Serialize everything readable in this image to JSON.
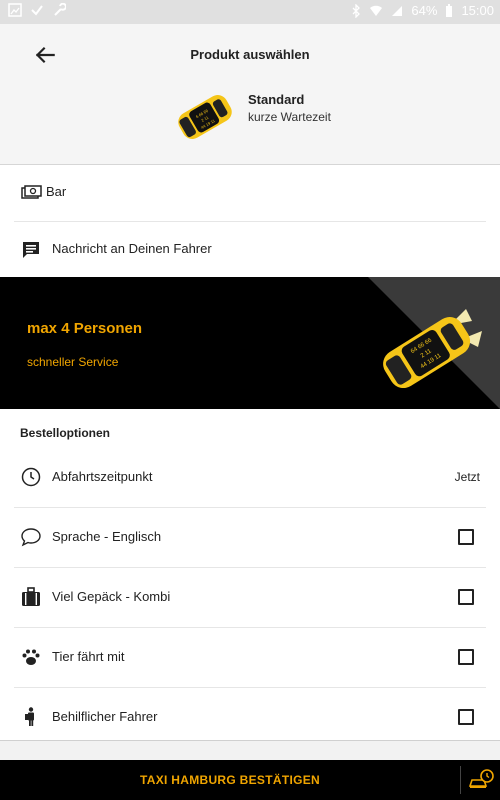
{
  "statusbar": {
    "battery": "64%",
    "time": "15:00"
  },
  "header": {
    "title": "Produkt auswählen",
    "product_name": "Standard",
    "product_subtitle": "kurze Wartezeit"
  },
  "top_list": [
    {
      "label": "Bar",
      "icon": "cash-icon"
    },
    {
      "label": "Nachricht an Deinen Fahrer",
      "icon": "message-icon"
    }
  ],
  "promo": {
    "title": "max 4 Personen",
    "subtitle": "schneller Service"
  },
  "options": {
    "section_title": "Bestelloptionen",
    "items": [
      {
        "label": "Abfahrtszeitpunkt",
        "value": "Jetzt",
        "icon": "clock-icon"
      },
      {
        "label": "Sprache - Englisch",
        "checked": false,
        "icon": "speech-bubble-icon"
      },
      {
        "label": "Viel Gepäck - Kombi",
        "checked": false,
        "icon": "luggage-icon"
      },
      {
        "label": "Tier fährt mit",
        "checked": false,
        "icon": "paw-icon"
      },
      {
        "label": "Behilflicher Fahrer",
        "checked": false,
        "icon": "assistant-person-icon"
      }
    ]
  },
  "footer": {
    "confirm_label": "TAXI HAMBURG BESTÄTIGEN"
  },
  "colors": {
    "accent": "#f0a500",
    "taxi_yellow": "#f5c518",
    "dark": "#000000"
  }
}
